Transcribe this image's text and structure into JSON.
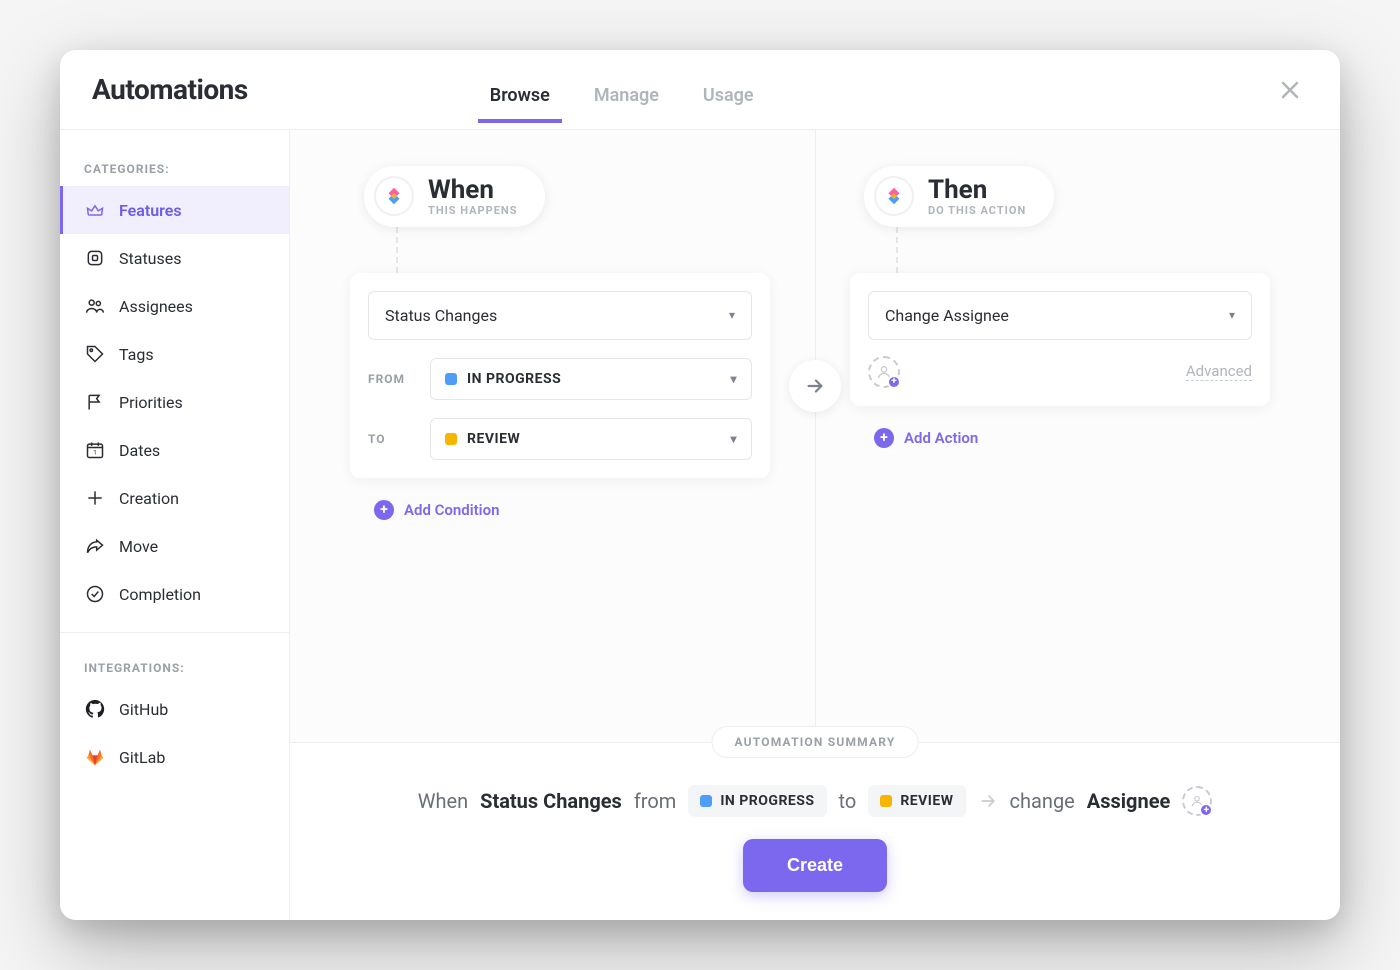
{
  "header": {
    "title": "Automations",
    "tabs": {
      "browse": "Browse",
      "manage": "Manage",
      "usage": "Usage"
    }
  },
  "sidebar": {
    "categories_label": "CATEGORIES:",
    "items": [
      {
        "label": "Features"
      },
      {
        "label": "Statuses"
      },
      {
        "label": "Assignees"
      },
      {
        "label": "Tags"
      },
      {
        "label": "Priorities"
      },
      {
        "label": "Dates"
      },
      {
        "label": "Creation"
      },
      {
        "label": "Move"
      },
      {
        "label": "Completion"
      }
    ],
    "integrations_label": "INTEGRATIONS:",
    "integrations": [
      {
        "label": "GitHub"
      },
      {
        "label": "GitLab"
      }
    ]
  },
  "when": {
    "title": "When",
    "subtitle": "THIS HAPPENS",
    "trigger": "Status Changes",
    "from_label": "FROM",
    "from_status": "IN PROGRESS",
    "to_label": "TO",
    "to_status": "REVIEW",
    "add_condition": "Add Condition"
  },
  "then": {
    "title": "Then",
    "subtitle": "DO THIS ACTION",
    "action": "Change Assignee",
    "advanced": "Advanced",
    "add_action": "Add Action"
  },
  "summary": {
    "badge": "AUTOMATION SUMMARY",
    "when_word": "When",
    "trigger": "Status Changes",
    "from_word": "from",
    "from_status": "IN PROGRESS",
    "to_word": "to",
    "to_status": "REVIEW",
    "change_word": "change",
    "target": "Assignee",
    "create": "Create"
  },
  "colors": {
    "accent": "#7b68ee",
    "in_progress": "#4f9cf9",
    "review": "#f7b500"
  }
}
